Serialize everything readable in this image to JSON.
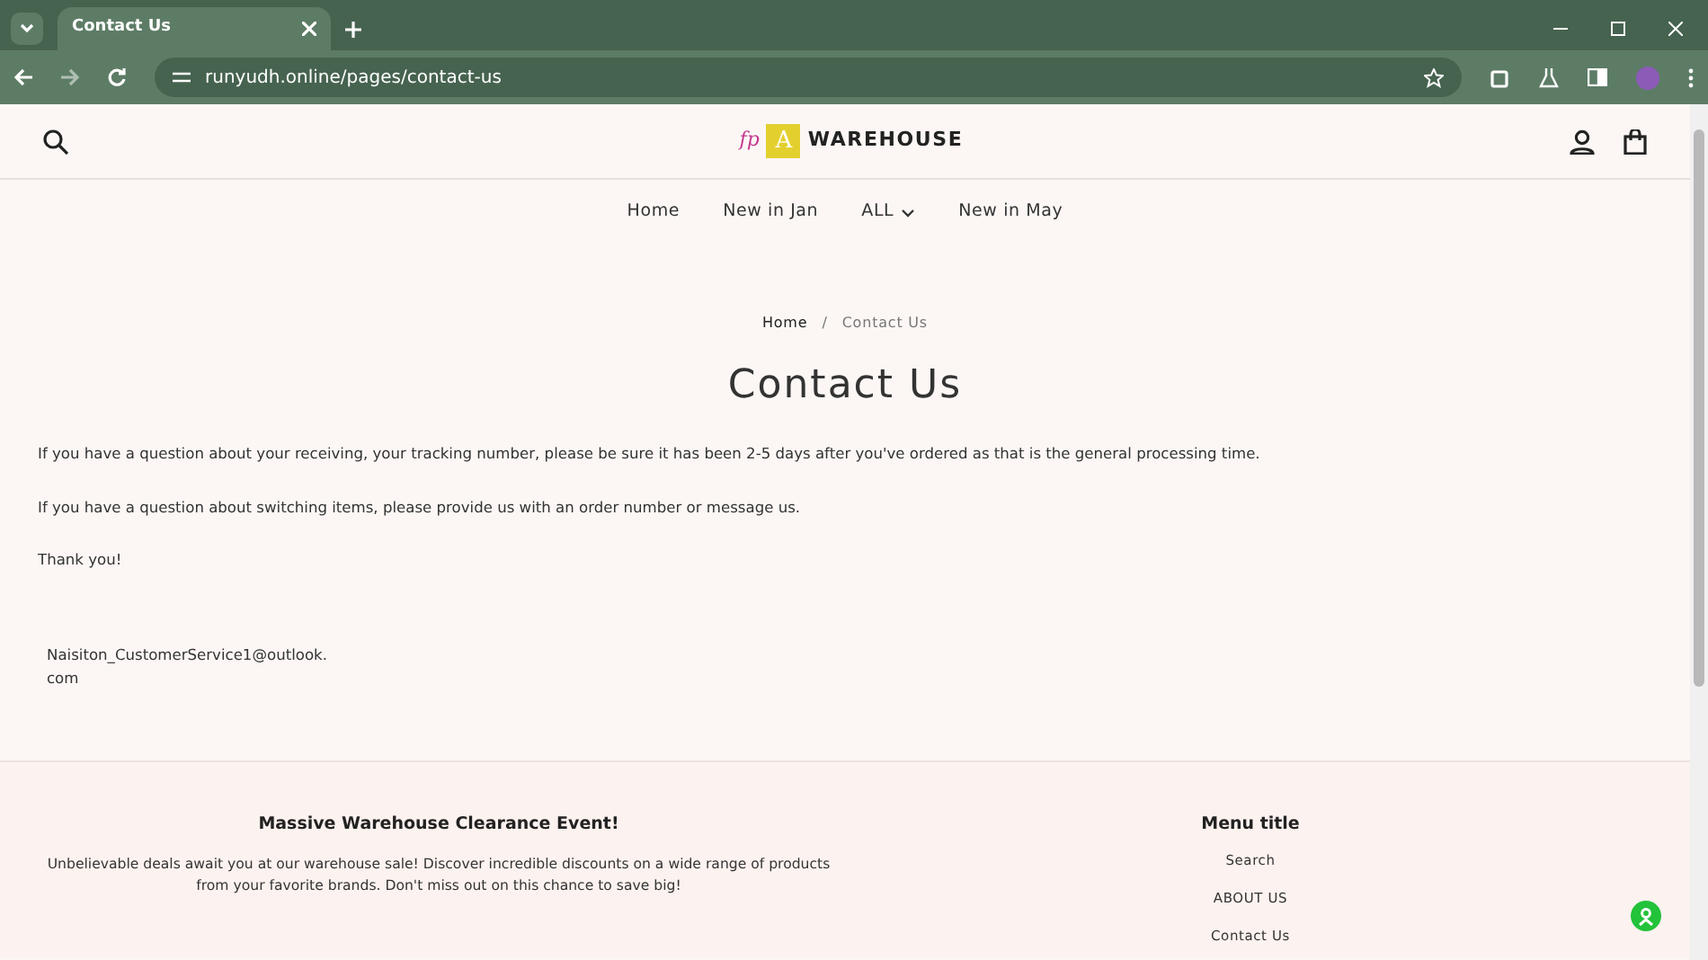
{
  "browser": {
    "tab": {
      "title": "Contact Us",
      "selected": true
    },
    "url": "runyudh.online/pages/contact-us"
  },
  "logo": {
    "script": "fp",
    "letter": "A",
    "word": "WAREHOUSE"
  },
  "nav": [
    {
      "label": "Home",
      "dropdown": false
    },
    {
      "label": "New in Jan",
      "dropdown": false
    },
    {
      "label": "ALL",
      "dropdown": true
    },
    {
      "label": "New in May",
      "dropdown": false
    }
  ],
  "breadcrumb": [
    "Home",
    "/",
    "Contact Us"
  ],
  "page_title": "Contact Us",
  "paragraphs": [
    "If you have a question about your receiving, your tracking number, please be sure it has been 2-5 days after you've ordered as that is the general processing time.",
    "If you have a question about switching items, please provide us with an order number or message us.",
    "Thank you!"
  ],
  "email": "Naisiton_CustomerService1@outlook.com",
  "footer": {
    "promo": {
      "title": "Massive Warehouse Clearance Event!",
      "text": "Unbelievable deals await you at our warehouse sale! Discover incredible discounts on a wide range of products from your favorite brands. Don't miss out on this chance to save big!"
    },
    "menu": {
      "title": "Menu title",
      "items": [
        "Search",
        "ABOUT US",
        "Contact Us"
      ]
    }
  }
}
